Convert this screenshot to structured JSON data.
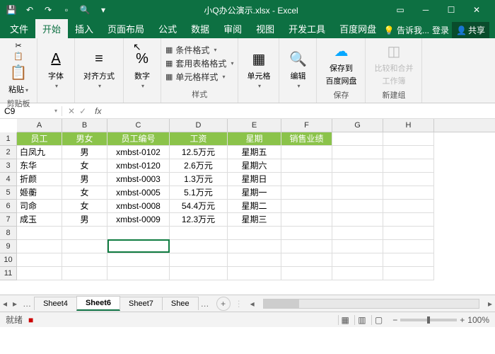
{
  "title": "小Q办公演示.xlsx - Excel",
  "menu": {
    "file": "文件",
    "home": "开始",
    "insert": "插入",
    "layout": "页面布局",
    "formula": "公式",
    "data": "数据",
    "review": "审阅",
    "view": "视图",
    "dev": "开发工具",
    "baidu": "百度网盘",
    "tell": "告诉我...",
    "login": "登录",
    "share": "共享"
  },
  "ribbon": {
    "clipboard": {
      "paste": "粘贴",
      "label": "剪贴板"
    },
    "font": {
      "label": "字体"
    },
    "align": {
      "label": "对齐方式"
    },
    "number": {
      "label": "数字"
    },
    "styles": {
      "cond": "条件格式",
      "table": "套用表格格式",
      "cell": "单元格样式",
      "label": "样式"
    },
    "cells": {
      "btn": "单元格"
    },
    "edit": {
      "btn": "编辑"
    },
    "save": {
      "line1": "保存到",
      "line2": "百度网盘",
      "label": "保存"
    },
    "compare": {
      "line1": "比较和合并",
      "line2": "工作簿",
      "label": "新建组"
    }
  },
  "namebox": "C9",
  "fx": "fx",
  "columns": [
    "A",
    "B",
    "C",
    "D",
    "E",
    "F",
    "G",
    "H"
  ],
  "headers": [
    "员工",
    "男女",
    "员工编号",
    "工资",
    "星期",
    "销售业绩"
  ],
  "data": [
    [
      "白凤九",
      "男",
      "xmbst-0102",
      "12.5万元",
      "星期五"
    ],
    [
      "东华",
      "女",
      "xmbst-0120",
      "2.6万元",
      "星期六"
    ],
    [
      "折颜",
      "男",
      "xmbst-0003",
      "1.3万元",
      "星期日"
    ],
    [
      "姬蘅",
      "女",
      "xmbst-0005",
      "5.1万元",
      "星期一"
    ],
    [
      "司命",
      "女",
      "xmbst-0008",
      "54.4万元",
      "星期二"
    ],
    [
      "成玉",
      "男",
      "xmbst-0009",
      "12.3万元",
      "星期三"
    ]
  ],
  "sheets": {
    "nav": "…",
    "s1": "Sheet4",
    "s2": "Sheet6",
    "s3": "Sheet7",
    "s4": "Shee",
    "more": "…"
  },
  "status": {
    "ready": "就绪",
    "rec": "■",
    "zoom": "100%"
  }
}
